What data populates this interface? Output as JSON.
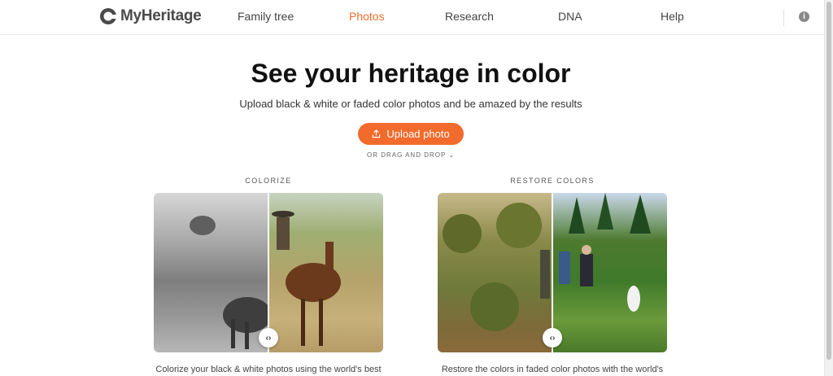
{
  "brand": {
    "name": "MyHeritage"
  },
  "nav": {
    "items": [
      {
        "label": "Family tree",
        "active": false
      },
      {
        "label": "Photos",
        "active": true
      },
      {
        "label": "Research",
        "active": false
      },
      {
        "label": "DNA",
        "active": false
      },
      {
        "label": "Help",
        "active": false
      }
    ]
  },
  "hero": {
    "title": "See your heritage in color",
    "subtitle": "Upload black & white or faded color photos and be amazed by the results",
    "upload_label": "Upload photo",
    "drag_drop": "OR DRAG AND DROP"
  },
  "features": [
    {
      "label": "COLORIZE",
      "caption": "Colorize your black & white photos using the world's best"
    },
    {
      "label": "RESTORE COLORS",
      "caption": "Restore the colors in faded color photos with the world's"
    }
  ],
  "colors": {
    "accent": "#f26b2c",
    "nav_active": "#f46e2e"
  },
  "icons": {
    "upload": "upload-icon",
    "chevron": "chevron-down-icon",
    "compare": "compare-handle-icon",
    "info": "info-icon"
  }
}
